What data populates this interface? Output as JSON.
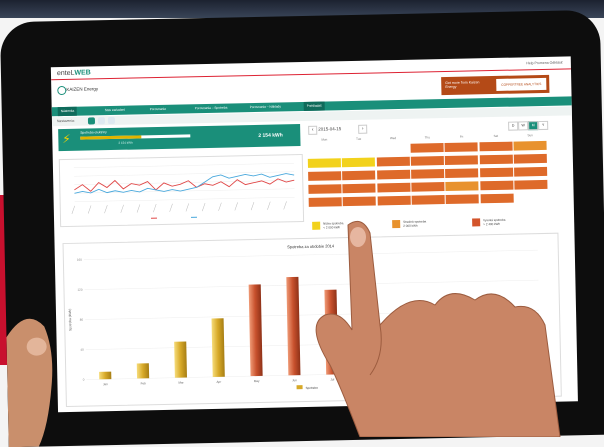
{
  "app": {
    "brand_prefix": "enteL",
    "brand_suffix": "WEB",
    "company": "KAIZEN",
    "product": "Energy",
    "top_links": "Help   Promena   Odhlásiť",
    "promo_text": "Get more from Kaizen Energy",
    "promo_logo": "COPPERTREE ANALYTICS"
  },
  "nav": {
    "tabs": [
      "Nástenka",
      "Stav zariadení",
      "Porovnania",
      "Porovnania – Spotreba",
      "Porovnania – Náklady",
      "Prehliadač"
    ]
  },
  "filter": {
    "label": "Nastavenia:"
  },
  "kpi": {
    "label": "Spotreba elektriny",
    "value": "2 154 kWh",
    "sub": "2 154 kWh",
    "fill_ratio": 0.55
  },
  "calendar": {
    "date": "2015-04-15",
    "prev": "‹",
    "next": "›",
    "views": [
      "D",
      "W",
      "M",
      "Y"
    ],
    "days": [
      "Mon",
      "Tue",
      "Wed",
      "Thu",
      "Fri",
      "Sat",
      "Sun"
    ],
    "rows": [
      [
        null,
        null,
        null,
        "o",
        "o",
        "o",
        "a"
      ],
      [
        "y",
        "y",
        "o",
        "o",
        "o",
        "o",
        "o"
      ],
      [
        "o",
        "o",
        "o",
        "o",
        "o",
        "o",
        "o"
      ],
      [
        "o",
        "o",
        "o",
        "o",
        "a",
        "o",
        "o"
      ],
      [
        "o",
        "o",
        "o",
        "o",
        "o",
        "o",
        null
      ]
    ],
    "colors": {
      "y": "#f2d21c",
      "o": "#de6a2a",
      "a": "#e8922e"
    }
  },
  "legend": [
    {
      "color": "#f2d21c",
      "label": "Nízka spotreba",
      "sub": "< 2 000 kWh"
    },
    {
      "color": "#e8922e",
      "label": "Stredná spotreba",
      "sub": "2 000 kWh"
    },
    {
      "color": "#d3542b",
      "label": "Vysoká spotreba",
      "sub": "> 2 400 kWh"
    }
  ],
  "colors": {
    "accent": "#1a8f7a",
    "gold": "#d7a928",
    "rust": "#c8512d"
  },
  "chart_data": [
    {
      "type": "line",
      "series": [
        {
          "values": [
            3.2,
            3.5,
            3.1,
            3.6,
            3.3,
            3.7,
            3.2,
            3.5,
            3.4,
            3.6,
            3.1,
            3.5,
            3.3,
            3.4,
            3.6,
            3.2,
            3.4,
            3.3,
            3.5,
            3.2,
            3.6,
            3.3,
            3.4,
            3.5,
            3.3,
            3.6,
            3.4,
            3.5
          ]
        },
        {
          "values": [
            3.0,
            3.1,
            3.0,
            3.2,
            3.0,
            3.1,
            3.0,
            3.1,
            3.0,
            3.2,
            3.1,
            3.0,
            3.1,
            3.0,
            3.1,
            3.2,
            3.5,
            3.8,
            3.9,
            3.7,
            3.8,
            3.9,
            3.8,
            3.9,
            3.7,
            3.8,
            3.9,
            3.8
          ]
        }
      ],
      "series_colors": [
        "#e04848",
        "#49a8dc"
      ]
    },
    {
      "type": "bar",
      "title": "Spotreba za obdobie 2014",
      "categories": [
        "Jan",
        "Feb",
        "Mar",
        "Apr",
        "May",
        "Jun",
        "Jul",
        "Aug",
        "Sep",
        "Oct",
        "Nov",
        "Dec"
      ],
      "values": [
        10,
        20,
        48,
        78,
        122,
        131,
        113,
        101,
        0,
        0,
        0,
        32
      ],
      "bar_kinds": [
        "g",
        "g",
        "g",
        "g",
        "r",
        "r",
        "r",
        "r",
        "g",
        "g",
        "g",
        "g"
      ],
      "ylim": [
        0,
        160
      ],
      "ylabel": "Spotreba (kWh)",
      "legend": "Spotreba"
    }
  ]
}
